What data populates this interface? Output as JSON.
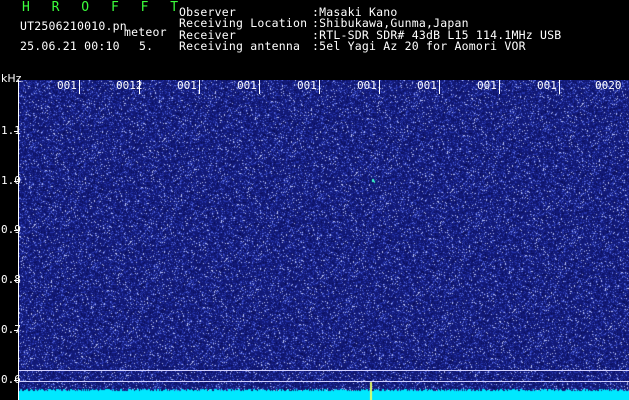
{
  "header": {
    "title": "H R O F F T",
    "filename": "UT2506210010.pn",
    "meteor_label": "meteor",
    "datetime": "25.06.21 00:10",
    "count": "5.",
    "fields": [
      {
        "label": "Observer",
        "value": ":Masaki Kano"
      },
      {
        "label": "Receiving Location",
        "value": ":Shibukawa,Gunma,Japan"
      },
      {
        "label": "Receiver",
        "value": ":RTL-SDR SDR# 43dB L15 114.1MHz USB"
      },
      {
        "label": "Receiving antenna",
        "value": ":5el Yagi Az 20 for Aomori VOR"
      }
    ]
  },
  "axis": {
    "y_unit": "kHz",
    "y_ticks": [
      "1.1",
      "1.0",
      "0.9",
      "0.8",
      "0.7",
      "0.6"
    ],
    "x_ticks": [
      "001",
      "0012",
      "001",
      "001",
      "001",
      "001",
      "001",
      "001",
      "001",
      "0020"
    ]
  },
  "colors": {
    "background": "#000000",
    "spectrogram_base": "#121a78",
    "header_green": "#3cff3c",
    "baseline_cyan": "#00e8ff"
  }
}
